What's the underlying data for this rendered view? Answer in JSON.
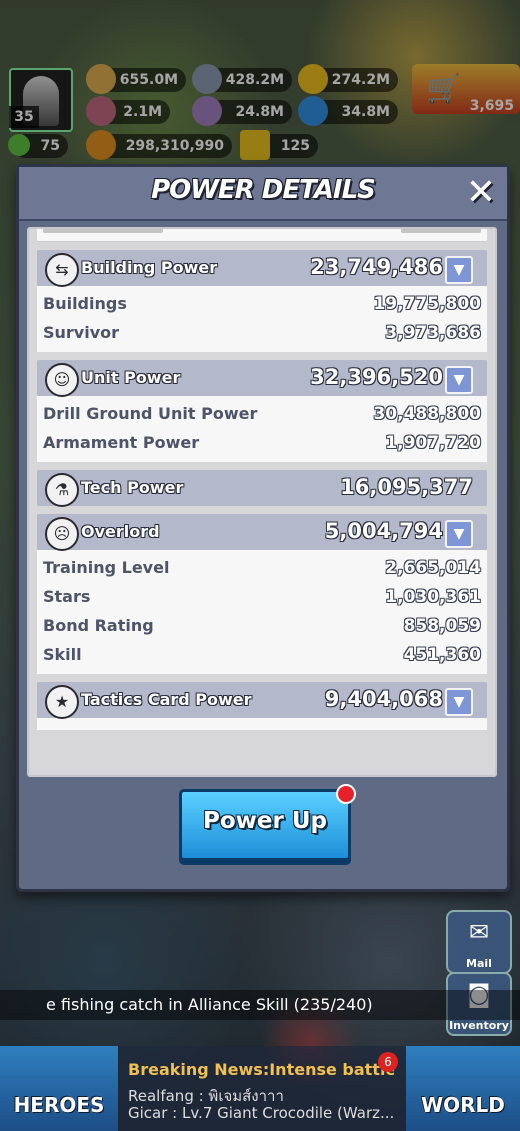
{
  "hud": {
    "level": "35",
    "food": "655.0M",
    "iron": "428.2M",
    "gold": "274.2M",
    "res2": "2.1M",
    "res3": "24.8M",
    "res4": "34.8M",
    "stamina": "75",
    "power": "298,310,990",
    "res5": "125",
    "gems": "3,695"
  },
  "dialog": {
    "title": "POWER DETAILS",
    "close_icon": "close-icon",
    "sections": [
      {
        "label": "Building Power",
        "value": "23,749,486",
        "icon": "signpost-icon",
        "rows": [
          {
            "k": "Buildings",
            "v": "19,775,800"
          },
          {
            "k": "Survivor",
            "v": "3,973,686"
          }
        ]
      },
      {
        "label": "Unit Power",
        "value": "32,396,520",
        "icon": "soldier-icon",
        "rows": [
          {
            "k": "Drill Ground Unit Power",
            "v": "30,488,800"
          },
          {
            "k": "Armament Power",
            "v": "1,907,720"
          }
        ]
      },
      {
        "label": "Tech Power",
        "value": "16,095,377",
        "icon": "flask-icon",
        "rows": []
      },
      {
        "label": "Overlord",
        "value": "5,004,794",
        "icon": "gorilla-icon",
        "rows": [
          {
            "k": "Training Level",
            "v": "2,665,014"
          },
          {
            "k": "Stars",
            "v": "1,030,361"
          },
          {
            "k": "Bond Rating",
            "v": "858,059"
          },
          {
            "k": "Skill",
            "v": "451,360"
          }
        ]
      },
      {
        "label": "Tactics Card Power",
        "value": "9,404,068",
        "icon": "star-badge-icon",
        "rows": []
      }
    ],
    "power_up_label": "Power Up"
  },
  "bottom": {
    "ticker": "e fishing catch in Alliance Skill (235/240)",
    "heroes_label": "HEROES",
    "world_label": "WORLD",
    "news": "Breaking News:Intense battle ...",
    "chat1": "Realfang : พิเจมส์งาาา",
    "chat2": "Gicar : Lv.7 Giant Crocodile (Warz...",
    "chat_badge": "6",
    "mail_label": "Mail",
    "inventory_label": "Inventory"
  }
}
